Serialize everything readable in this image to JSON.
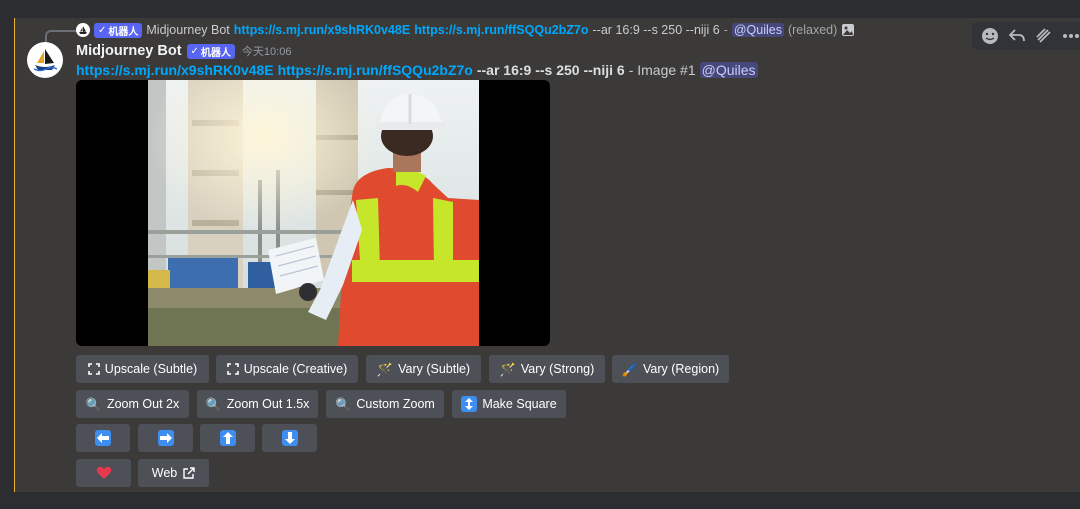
{
  "reply": {
    "badge": "机器人",
    "author": "Midjourney Bot",
    "link1": "https://s.mj.run/x9shRK0v48E",
    "link2": "https://s.mj.run/ffSQQu2bZ7o",
    "params": "--ar 16:9 --s 250 --niji 6",
    "separator": "-",
    "mention": "@Quiles",
    "mode": "(relaxed)"
  },
  "message": {
    "author": "Midjourney Bot",
    "badge": "机器人",
    "timestamp": "今天10:06",
    "link1": "https://s.mj.run/x9shRK0v48E",
    "link2": "https://s.mj.run/ffSQQu2bZ7o",
    "params": "--ar 16:9 --s 250 --niji 6",
    "suffix": "- Image #1",
    "mention": "@Quiles"
  },
  "buttons": {
    "upscale_subtle": "Upscale (Subtle)",
    "upscale_creative": "Upscale (Creative)",
    "vary_subtle": "Vary (Subtle)",
    "vary_strong": "Vary (Strong)",
    "vary_region": "Vary (Region)",
    "zoom_out_2x": "Zoom Out 2x",
    "zoom_out_1_5x": "Zoom Out 1.5x",
    "custom_zoom": "Custom Zoom",
    "make_square": "Make Square",
    "web": "Web"
  },
  "icons": {
    "expand": "expand-icon",
    "sparkle_wand": "magic-wand-icon",
    "brush": "brush-icon",
    "magnifier": "magnifier-icon",
    "updown": "up-down-arrow-icon",
    "heart": "heart-icon",
    "external": "external-link-icon"
  },
  "colors": {
    "link": "#00a8fc",
    "badge": "#5865f2",
    "button": "#4e5058",
    "accent_bar": "#f0b232",
    "arrow_box": "#3d8ef0",
    "heart": "#e8384f"
  }
}
